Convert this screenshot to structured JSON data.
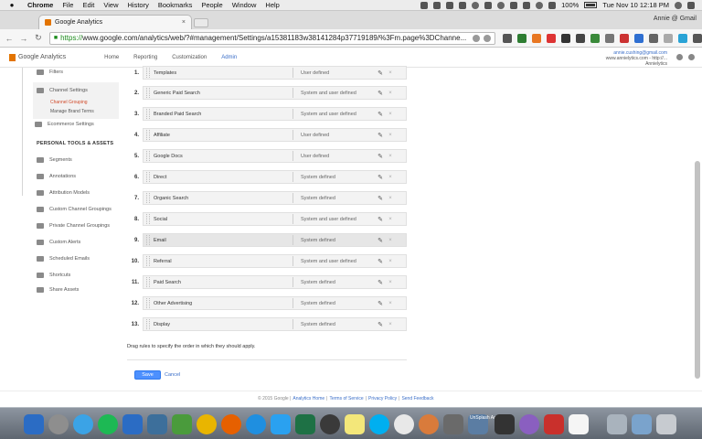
{
  "menubar": {
    "apple": "",
    "app": "Chrome",
    "items": [
      "File",
      "Edit",
      "View",
      "History",
      "Bookmarks",
      "People",
      "Window",
      "Help"
    ],
    "battery": "100%",
    "clock": "Tue Nov 10  12:18 PM"
  },
  "browser": {
    "tab_title": "Google Analytics",
    "tab_close": "×",
    "profile": "Annie @ Gmail",
    "url_scheme": "https://",
    "url_rest": "www.google.com/analytics/web/?#management/Settings/a15381183w38141284p37719189/%3Fm.page%3DChanne..."
  },
  "ga": {
    "logo": "Google Analytics",
    "nav": [
      "Home",
      "Reporting",
      "Customization",
      "Admin"
    ],
    "account_email": "annie.cushing@gmail.com",
    "account_line2": "www.annielytics.com - http://...",
    "account_line3": "Annielytics"
  },
  "sidebar": {
    "filters": "Filters",
    "channel_settings": "Channel Settings",
    "channel_grouping": "Channel Grouping",
    "manage_brand_terms": "Manage Brand Terms",
    "ecommerce_settings": "Ecommerce Settings",
    "personal_heading": "PERSONAL TOOLS & ASSETS",
    "segments": "Segments",
    "annotations": "Annotations",
    "attribution_models": "Attribution Models",
    "custom_channel_groupings": "Custom Channel Groupings",
    "private_channel_groupings": "Private Channel Groupings",
    "custom_alerts": "Custom Alerts",
    "scheduled_emails": "Scheduled Emails",
    "shortcuts": "Shortcuts",
    "share_assets": "Share Assets"
  },
  "rules": [
    {
      "num": "1.",
      "name": "Templates",
      "type": "User defined"
    },
    {
      "num": "2.",
      "name": "Generic Paid Search",
      "type": "System and user defined"
    },
    {
      "num": "3.",
      "name": "Branded Paid Search",
      "type": "System and user defined"
    },
    {
      "num": "4.",
      "name": "Affiliate",
      "type": "User defined"
    },
    {
      "num": "5.",
      "name": "Google Docs",
      "type": "User defined"
    },
    {
      "num": "6.",
      "name": "Direct",
      "type": "System defined"
    },
    {
      "num": "7.",
      "name": "Organic Search",
      "type": "System defined"
    },
    {
      "num": "8.",
      "name": "Social",
      "type": "System and user defined"
    },
    {
      "num": "9.",
      "name": "Email",
      "type": "System defined"
    },
    {
      "num": "10.",
      "name": "Referral",
      "type": "System and user defined"
    },
    {
      "num": "11.",
      "name": "Paid Search",
      "type": "System defined"
    },
    {
      "num": "12.",
      "name": "Other Advertising",
      "type": "System defined"
    },
    {
      "num": "13.",
      "name": "Display",
      "type": "System defined"
    }
  ],
  "form": {
    "drag_note": "Drag rules to specify the order in which they should apply.",
    "save": "Save",
    "cancel": "Cancel"
  },
  "footer": {
    "copyright": "© 2015 Google |",
    "analytics_home": "Analytics Home",
    "terms": "Terms of Service",
    "privacy": "Privacy Policy",
    "feedback": "Send Feedback",
    "sep1": "|",
    "sep2": "|",
    "sep3": "|"
  },
  "dock": {
    "unsplash_label": "UnSplash Action"
  },
  "colors": {
    "admin_active": "#3a6ec8",
    "subnav_active": "#d14b2b",
    "save_button": "#4d90fe",
    "ga_brand": "#e37400"
  }
}
